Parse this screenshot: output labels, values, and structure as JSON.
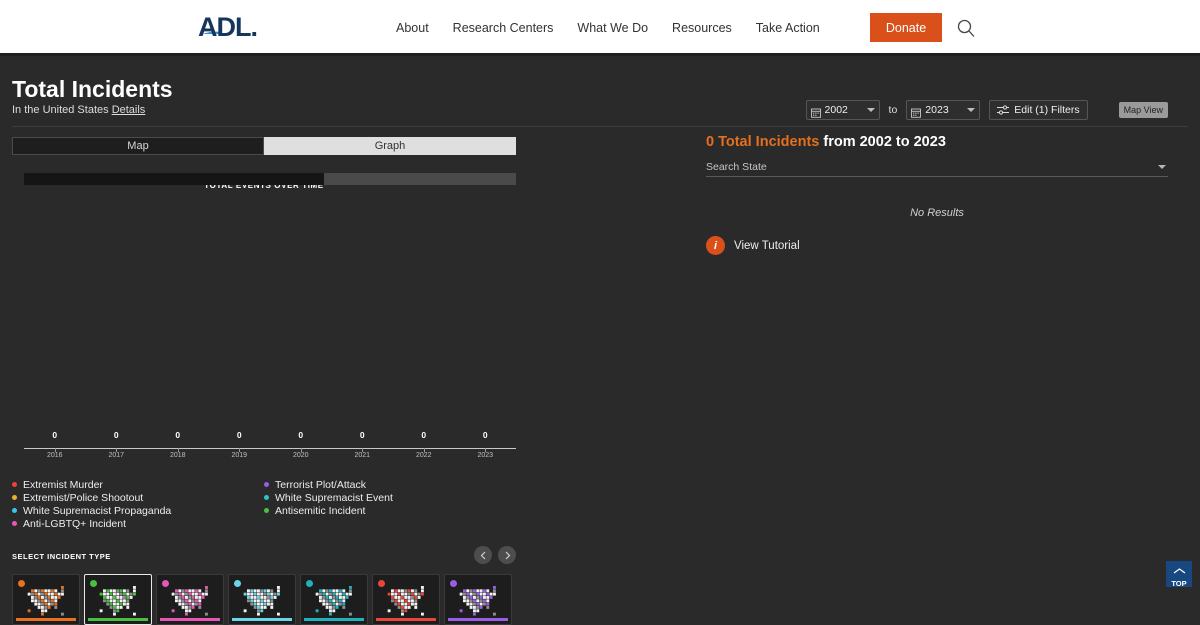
{
  "header": {
    "logo_text": "ADL",
    "nav_items": [
      {
        "label": "About"
      },
      {
        "label": "Research Centers"
      },
      {
        "label": "What We Do"
      },
      {
        "label": "Resources"
      },
      {
        "label": "Take Action"
      }
    ],
    "donate_label": "Donate",
    "search_icon": "search-icon"
  },
  "page": {
    "title": "Total Incidents",
    "subtitle": "In the United States",
    "details_link": "Details"
  },
  "filters": {
    "start_year": "2002",
    "end_year": "2023",
    "to_label": "to",
    "edit_filters_label": "Edit (1) Filters",
    "map_view_label": "Map View",
    "calendar_icon": "calendar-icon",
    "sliders_icon": "sliders-icon"
  },
  "view_tabs": [
    {
      "label": "Map",
      "active": false
    },
    {
      "label": "Graph",
      "active": true
    }
  ],
  "chart_data": {
    "type": "bar",
    "title": "TOTAL EVENTS OVER TIME",
    "categories": [
      "2016",
      "2017",
      "2018",
      "2019",
      "2020",
      "2021",
      "2022",
      "2023"
    ],
    "values": [
      0,
      0,
      0,
      0,
      0,
      0,
      0,
      0
    ],
    "value_labels": [
      "0",
      "0",
      "0",
      "0",
      "0",
      "0",
      "0",
      "0"
    ],
    "xlabel": "",
    "ylabel": "",
    "ylim": [
      0,
      0
    ],
    "grid": false,
    "legend_position": "below",
    "series": [
      {
        "name": "Extremist Murder",
        "color": "#e8463a",
        "values": [
          0,
          0,
          0,
          0,
          0,
          0,
          0,
          0
        ]
      },
      {
        "name": "Extremist/Police Shootout",
        "color": "#e8b32c",
        "values": [
          0,
          0,
          0,
          0,
          0,
          0,
          0,
          0
        ]
      },
      {
        "name": "White Supremacist Propaganda",
        "color": "#35c6e8",
        "values": [
          0,
          0,
          0,
          0,
          0,
          0,
          0,
          0
        ]
      },
      {
        "name": "Anti-LGBTQ+ Incident",
        "color": "#e857b4",
        "values": [
          0,
          0,
          0,
          0,
          0,
          0,
          0,
          0
        ]
      },
      {
        "name": "Terrorist Plot/Attack",
        "color": "#9b5de5",
        "values": [
          0,
          0,
          0,
          0,
          0,
          0,
          0,
          0
        ]
      },
      {
        "name": "White Supremacist Event",
        "color": "#2ec4c4",
        "values": [
          0,
          0,
          0,
          0,
          0,
          0,
          0,
          0
        ]
      },
      {
        "name": "Antisemitic Incident",
        "color": "#49c13f",
        "values": [
          0,
          0,
          0,
          0,
          0,
          0,
          0,
          0
        ]
      }
    ],
    "brush_selection_percent": 61
  },
  "legend": {
    "column_left": [
      {
        "label": "Extremist Murder",
        "color": "#e8463a"
      },
      {
        "label": "Extremist/Police Shootout",
        "color": "#e8b32c"
      },
      {
        "label": "White Supremacist Propaganda",
        "color": "#35c6e8"
      },
      {
        "label": "Anti-LGBTQ+ Incident",
        "color": "#e857b4"
      }
    ],
    "column_right": [
      {
        "label": "Terrorist Plot/Attack",
        "color": "#9b5de5"
      },
      {
        "label": "White Supremacist Event",
        "color": "#2ec4c4"
      },
      {
        "label": "Antisemitic Incident",
        "color": "#49c13f"
      }
    ]
  },
  "incident_selector": {
    "title": "SELECT INCIDENT TYPE",
    "prev_icon": "chevron-left-icon",
    "next_icon": "chevron-right-icon",
    "cards": [
      {
        "color": "#e8701f",
        "selected": false
      },
      {
        "color": "#49c13f",
        "selected": true
      },
      {
        "color": "#e857b4",
        "selected": false
      },
      {
        "color": "#6ad4e8",
        "selected": false
      },
      {
        "color": "#1fb2bd",
        "selected": false
      },
      {
        "color": "#e8463a",
        "selected": false
      },
      {
        "color": "#9b5de5",
        "selected": false
      }
    ]
  },
  "results": {
    "count_text": "0 Total Incidents",
    "range_text": " from 2002 to 2023",
    "state_search_placeholder": "Search State",
    "state_search_value": "",
    "no_results_text": "No Results",
    "tutorial_label": "View Tutorial",
    "info_icon": "info-icon"
  },
  "back_to_top": {
    "label": "TOP",
    "icon": "chevron-up-icon"
  }
}
